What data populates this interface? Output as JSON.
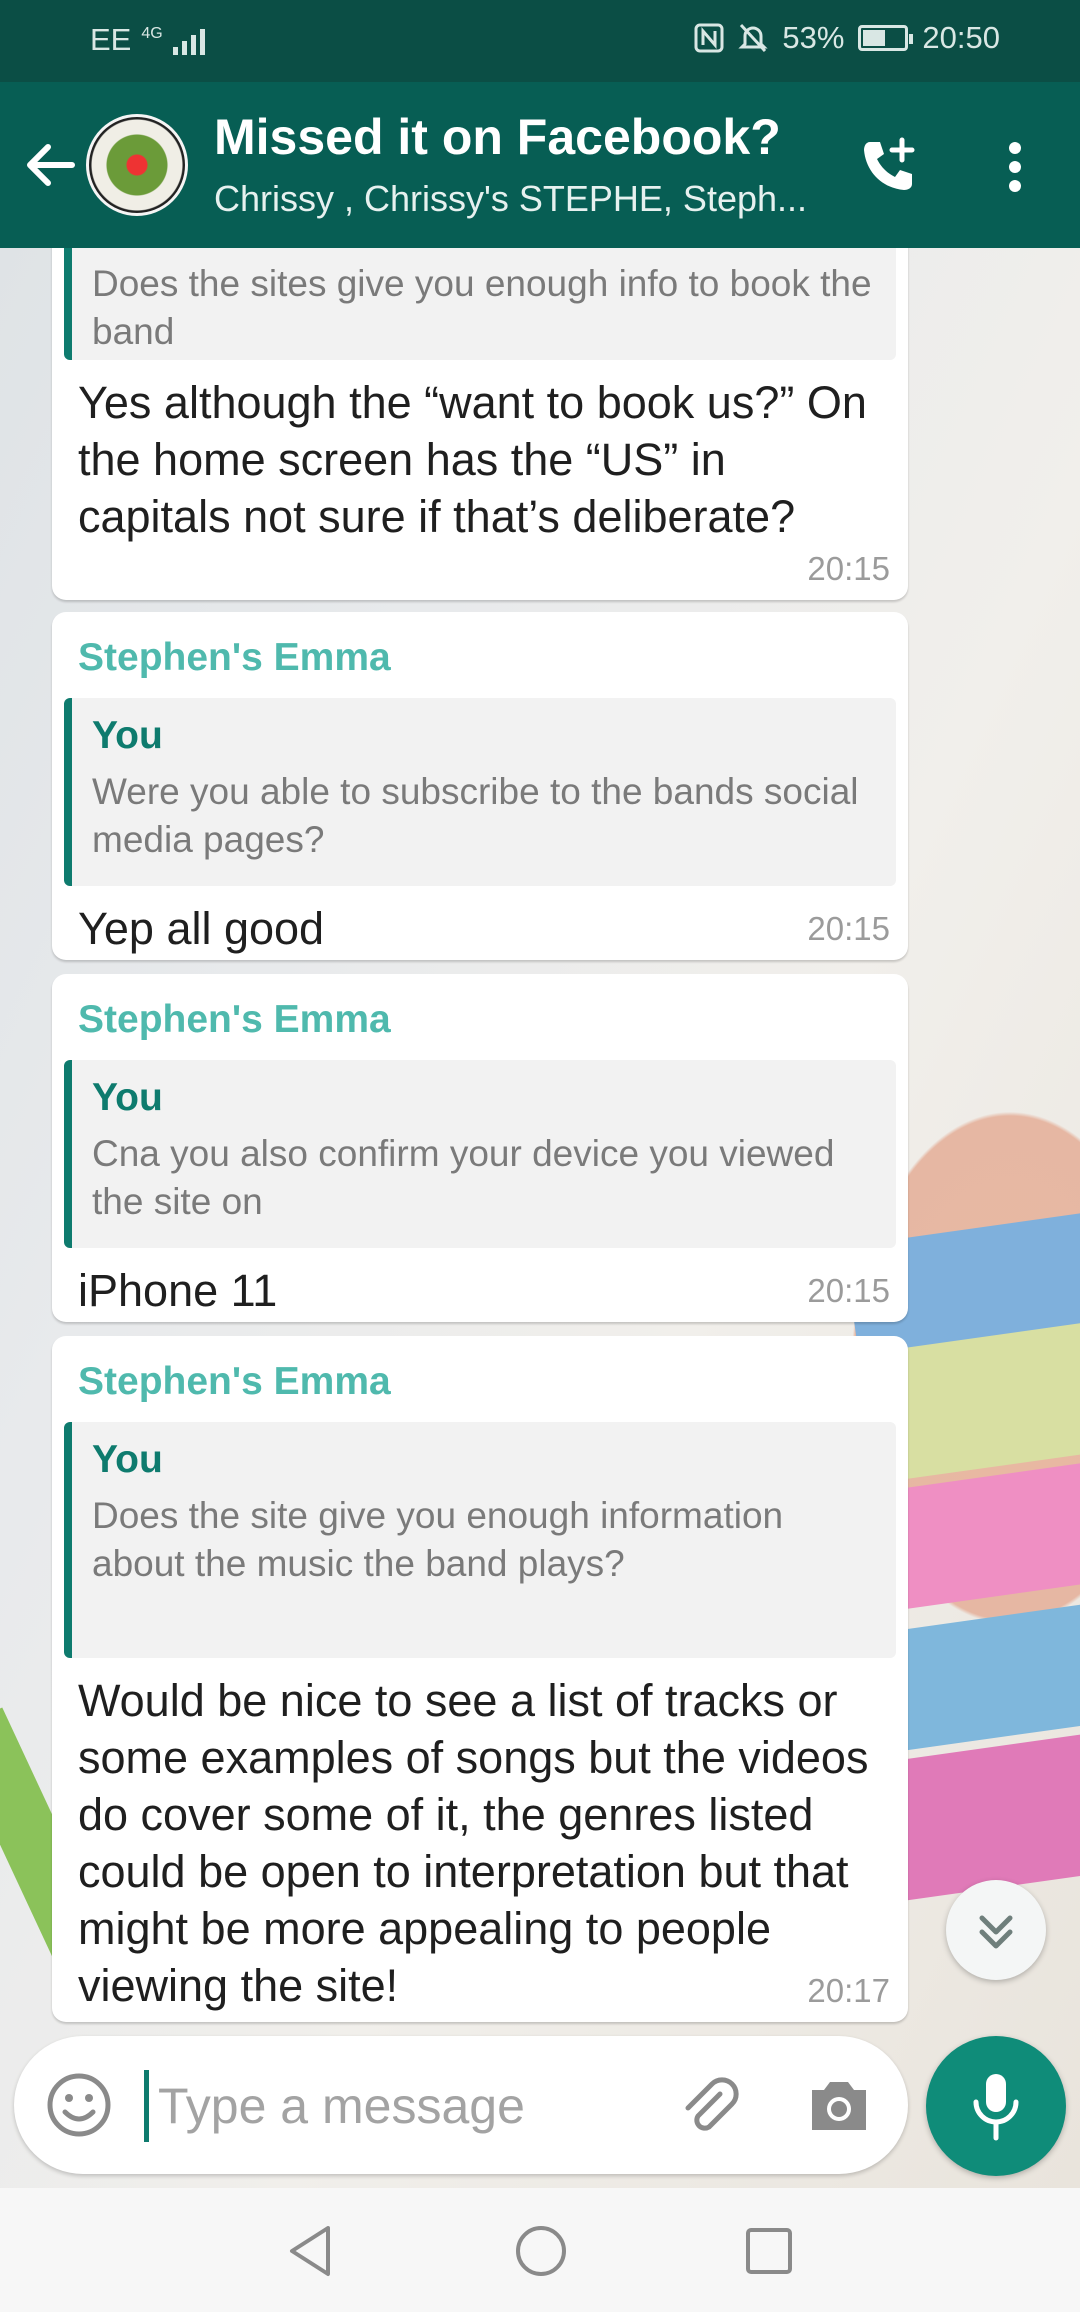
{
  "status_bar": {
    "carrier": "EE",
    "network": "4G",
    "battery": "53%",
    "battery_level": 0.53,
    "time": "20:50"
  },
  "header": {
    "title": "Missed it on Facebook?",
    "subtitle": "Chrissy , Chrissy's STEPHE, Steph...",
    "icons": [
      "back-arrow",
      "group-avatar",
      "add-call",
      "more-vert"
    ]
  },
  "messages": [
    {
      "quote_text": "Does the sites give you enough info to book the band",
      "body": "Yes although the “want to book us?” On the home screen has the “US” in capitals not sure if that’s deliberate?",
      "time": "20:15"
    },
    {
      "sender": "Stephen's Emma",
      "quote_author": "You",
      "quote_text": "Were you able to subscribe to the bands social media pages?",
      "body": "Yep all good",
      "time": "20:15"
    },
    {
      "sender": "Stephen's Emma",
      "quote_author": "You",
      "quote_text": "Cna you also confirm your device you viewed the site on",
      "body": "iPhone 11",
      "time": "20:15"
    },
    {
      "sender": "Stephen's Emma",
      "quote_author": "You",
      "quote_text": "Does the site give you enough information about the music the band plays?",
      "body": "Would be nice to see a list of tracks or some examples of songs but the videos do cover some of it, the genres listed could be open to interpretation but that might be more appealing to people viewing the site!",
      "time": "20:17"
    }
  ],
  "composer": {
    "placeholder": "Type a message",
    "value": ""
  },
  "colors": {
    "header": "#075e54",
    "status_bar": "#0b4e45",
    "sender": "#4fb9ad",
    "quote_accent": "#0e7b6e",
    "mic": "#0f8c79"
  }
}
